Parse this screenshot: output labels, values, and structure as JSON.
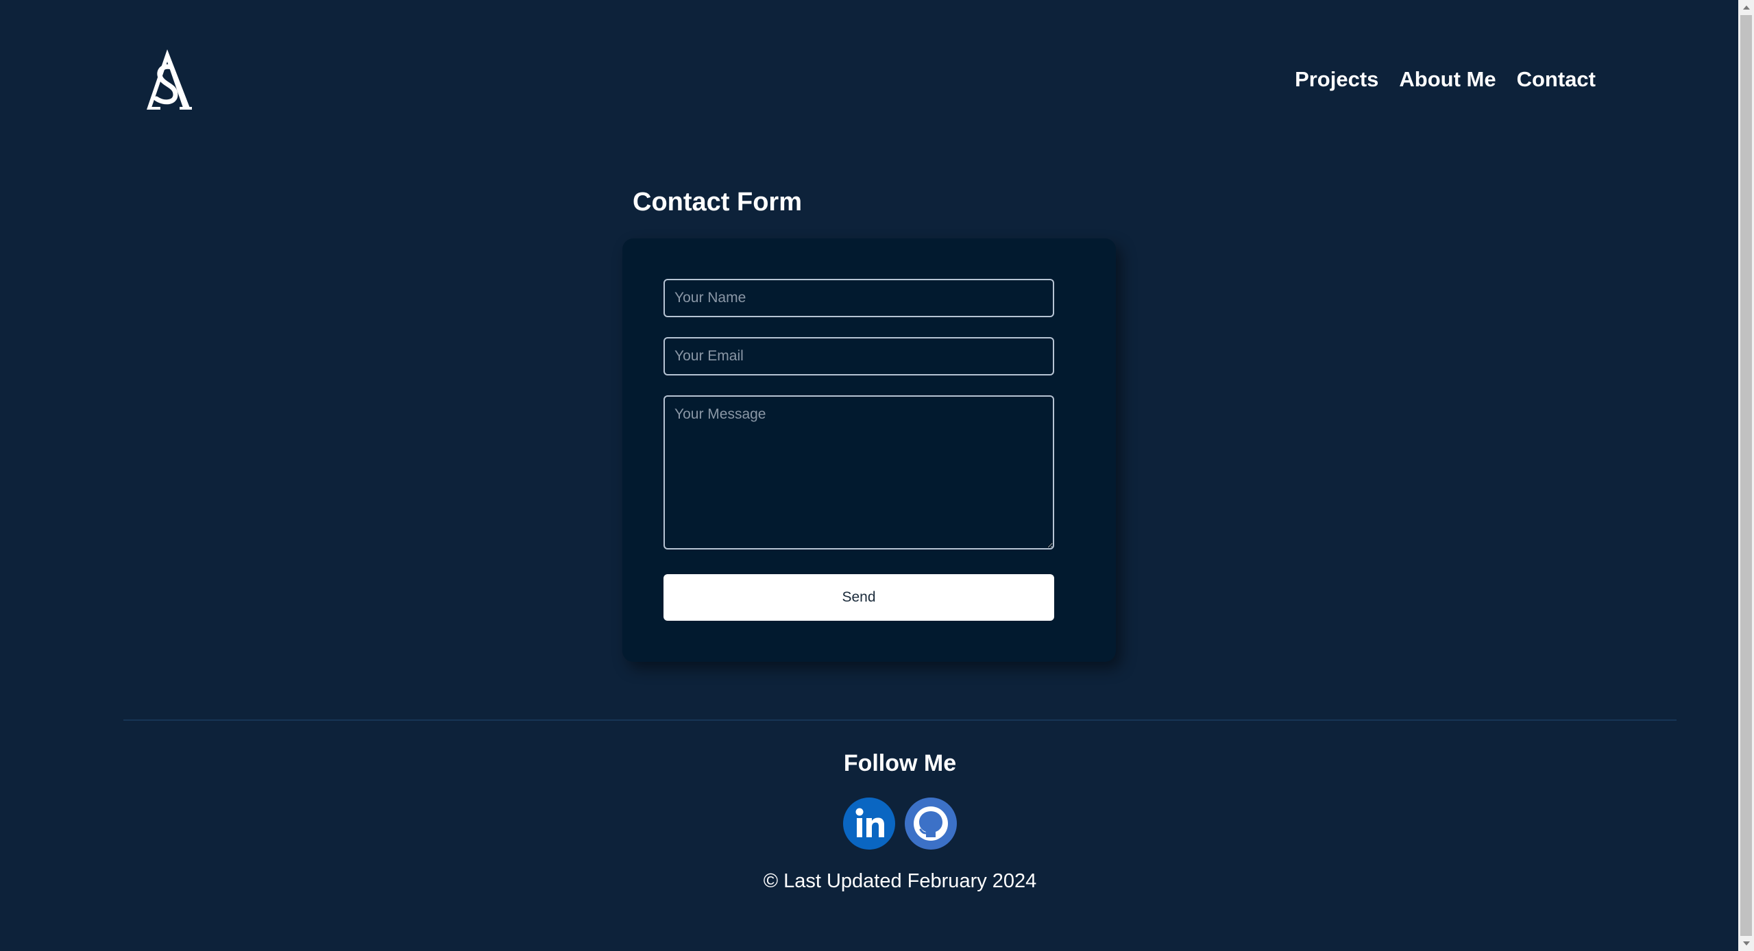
{
  "header": {
    "logo_icon": "monogram-as-logo",
    "nav": [
      {
        "label": "Projects"
      },
      {
        "label": "About Me"
      },
      {
        "label": "Contact"
      }
    ]
  },
  "contact_form": {
    "title": "Contact Form",
    "name_placeholder": "Your Name",
    "email_placeholder": "Your Email",
    "message_placeholder": "Your Message",
    "send_label": "Send"
  },
  "footer": {
    "follow_title": "Follow Me",
    "social": [
      {
        "icon": "linkedin-icon",
        "color": "#0a66c2"
      },
      {
        "icon": "github-icon",
        "color": "#3c71c7"
      }
    ],
    "copyright": "© Last Updated February 2024"
  },
  "colors": {
    "background": "#0d223a",
    "card": "#021a2f",
    "accent_text": "#ffffff"
  }
}
